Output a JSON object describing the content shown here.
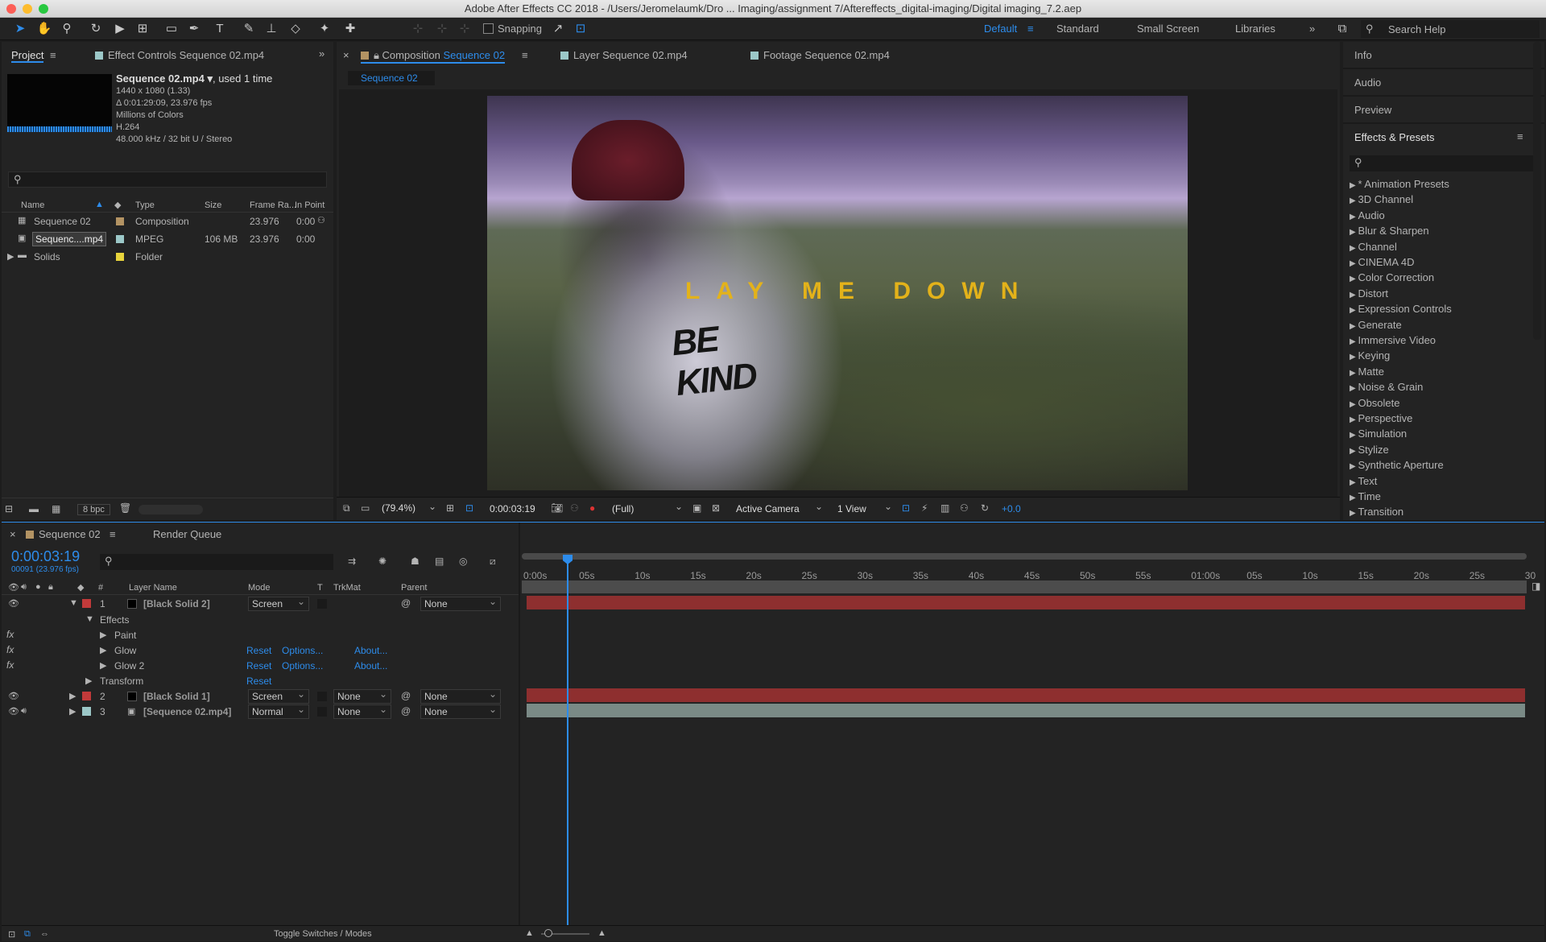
{
  "titlebar": {
    "title": "Adobe After Effects CC 2018 - /Users/Jeromelaumk/Dro ... Imaging/assignment 7/Aftereffects_digital-imaging/Digital imaging_7.2.aep"
  },
  "toolbar": {
    "snapping": "Snapping",
    "workspaces": [
      "Default",
      "Standard",
      "Small Screen",
      "Libraries"
    ],
    "search_help": "Search Help"
  },
  "project_panel": {
    "tabs": [
      "Project",
      "Effect Controls Sequence 02.mp4"
    ],
    "info": {
      "name": "Sequence 02.mp4 ▾",
      "used": ", used 1 time",
      "lines": [
        "1440 x 1080 (1.33)",
        "Δ 0:01:29:09, 23.976 fps",
        "Millions of Colors",
        "H.264",
        "48.000 kHz / 32 bit U / Stereo"
      ]
    },
    "columns": [
      "Name",
      "Type",
      "Size",
      "Frame Ra...",
      "In Point"
    ],
    "items": [
      {
        "name": "Sequence 02",
        "type": "Composition",
        "size": "",
        "fps": "23.976",
        "in": "0:00",
        "color": "#b39363"
      },
      {
        "name": "Sequenc....mp4",
        "type": "MPEG",
        "size": "106 MB",
        "fps": "23.976",
        "in": "0:00",
        "color": "#9cc8c8"
      },
      {
        "name": "Solids",
        "type": "Folder",
        "size": "",
        "fps": "",
        "in": "",
        "color": "#e8d43c"
      }
    ],
    "bpc": "8 bpc"
  },
  "viewer": {
    "tabs": [
      "Composition",
      "Sequence 02",
      "Layer Sequence 02.mp4",
      "Footage Sequence 02.mp4"
    ],
    "comp_label": "Sequence 02",
    "overlay_text": "LAY ME DOWN",
    "shirt_text": "BE KIND",
    "zoom": "(79.4%)",
    "timecode": "0:00:03:19",
    "resolution": "(Full)",
    "camera": "Active Camera",
    "views": "1 View",
    "exposure": "+0.0"
  },
  "right_panels": {
    "sections": [
      "Info",
      "Audio",
      "Preview",
      "Effects & Presets"
    ],
    "effects": [
      "* Animation Presets",
      "3D Channel",
      "Audio",
      "Blur & Sharpen",
      "Channel",
      "CINEMA 4D",
      "Color Correction",
      "Distort",
      "Expression Controls",
      "Generate",
      "Immersive Video",
      "Keying",
      "Matte",
      "Noise & Grain",
      "Obsolete",
      "Perspective",
      "Simulation",
      "Stylize",
      "Synthetic Aperture",
      "Text",
      "Time",
      "Transition"
    ]
  },
  "timeline": {
    "tabs": [
      "Sequence 02",
      "Render Queue"
    ],
    "current_time": "0:00:03:19",
    "frame_info": "00091 (23.976 fps)",
    "columns": [
      "#",
      "Layer Name",
      "Mode",
      "T",
      "TrkMat",
      "Parent"
    ],
    "ruler": [
      "0:00s",
      "05s",
      "10s",
      "15s",
      "20s",
      "25s",
      "30s",
      "35s",
      "40s",
      "45s",
      "50s",
      "55s",
      "01:00s",
      "05s",
      "10s",
      "15s",
      "20s",
      "25s",
      "30"
    ],
    "layers": [
      {
        "num": "1",
        "name": "[Black Solid 2]",
        "mode": "Screen",
        "trkmat": "",
        "parent": "None",
        "color": "#c23a3a"
      },
      {
        "num": "2",
        "name": "[Black Solid 1]",
        "mode": "Screen",
        "trkmat": "None",
        "parent": "None",
        "color": "#c23a3a"
      },
      {
        "num": "3",
        "name": "[Sequence 02.mp4]",
        "mode": "Normal",
        "trkmat": "None",
        "parent": "None",
        "color": "#9cc8c8"
      }
    ],
    "effects_label": "Effects",
    "effects": [
      {
        "name": "Paint",
        "reset": "",
        "options": "",
        "about": ""
      },
      {
        "name": "Glow",
        "reset": "Reset",
        "options": "Options...",
        "about": "About..."
      },
      {
        "name": "Glow 2",
        "reset": "Reset",
        "options": "Options...",
        "about": "About..."
      }
    ],
    "transform": {
      "name": "Transform",
      "reset": "Reset"
    },
    "toggle": "Toggle Switches / Modes"
  }
}
